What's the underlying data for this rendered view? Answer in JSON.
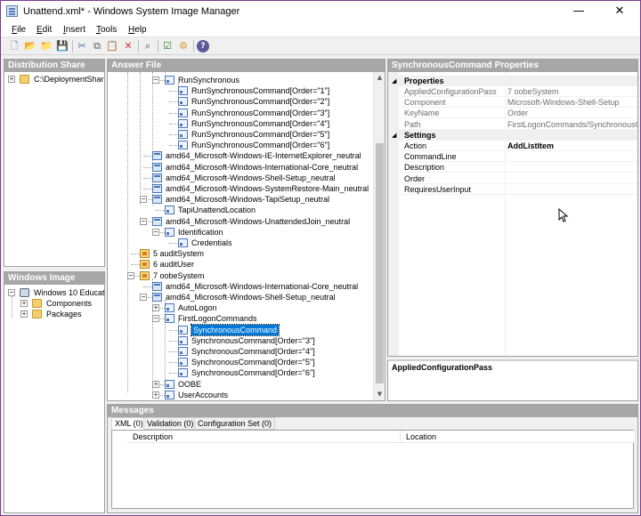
{
  "window": {
    "title": "Unattend.xml* - Windows System Image Manager",
    "minimize": "—",
    "maximize": "☐",
    "close": "✕"
  },
  "menu": [
    "File",
    "Edit",
    "Insert",
    "Tools",
    "Help"
  ],
  "toolbar_icons": [
    "new-icon",
    "open-icon",
    "open-folder-icon",
    "save-icon",
    "cut-icon",
    "copy-icon",
    "paste-icon",
    "delete-icon",
    "search-icon",
    "validate-icon",
    "create-config-set-icon",
    "help-icon"
  ],
  "distribution_share": {
    "header": "Distribution Share",
    "root": "C:\\DeploymentShare"
  },
  "windows_image": {
    "header": "Windows Image",
    "root": "Windows 10 Educatio",
    "children": [
      "Components",
      "Packages"
    ]
  },
  "answer_file": {
    "header": "Answer File",
    "rows": [
      {
        "label": "RunSynchronous",
        "icon": "set",
        "expander": "−"
      },
      {
        "label": "RunSynchronousCommand[Order=\"1\"]",
        "icon": "set",
        "expander": ""
      },
      {
        "label": "RunSynchronousCommand[Order=\"2\"]",
        "icon": "set",
        "expander": ""
      },
      {
        "label": "RunSynchronousCommand[Order=\"3\"]",
        "icon": "set",
        "expander": ""
      },
      {
        "label": "RunSynchronousCommand[Order=\"4\"]",
        "icon": "set",
        "expander": ""
      },
      {
        "label": "RunSynchronousCommand[Order=\"5\"]",
        "icon": "set",
        "expander": ""
      },
      {
        "label": "RunSynchronousCommand[Order=\"6\"]",
        "icon": "set",
        "expander": ""
      },
      {
        "label": "amd64_Microsoft-Windows-IE-InternetExplorer_neutral",
        "icon": "comp",
        "expander": ""
      },
      {
        "label": "amd64_Microsoft-Windows-International-Core_neutral",
        "icon": "comp",
        "expander": ""
      },
      {
        "label": "amd64_Microsoft-Windows-Shell-Setup_neutral",
        "icon": "comp",
        "expander": ""
      },
      {
        "label": "amd64_Microsoft-Windows-SystemRestore-Main_neutral",
        "icon": "comp",
        "expander": ""
      },
      {
        "label": "amd64_Microsoft-Windows-TapiSetup_neutral",
        "icon": "comp",
        "expander": "−"
      },
      {
        "label": "TapiUnattendLocation",
        "icon": "set",
        "expander": ""
      },
      {
        "label": "amd64_Microsoft-Windows-UnattendedJoin_neutral",
        "icon": "comp",
        "expander": "−"
      },
      {
        "label": "Identification",
        "icon": "set",
        "expander": "−"
      },
      {
        "label": "Credentials",
        "icon": "set",
        "expander": ""
      },
      {
        "label": "5 auditSystem",
        "icon": "pass",
        "expander": ""
      },
      {
        "label": "6 auditUser",
        "icon": "pass",
        "expander": ""
      },
      {
        "label": "7 oobeSystem",
        "icon": "pass",
        "expander": "−"
      },
      {
        "label": "amd64_Microsoft-Windows-International-Core_neutral",
        "icon": "comp",
        "expander": ""
      },
      {
        "label": "amd64_Microsoft-Windows-Shell-Setup_neutral",
        "icon": "comp",
        "expander": "−"
      },
      {
        "label": "AutoLogon",
        "icon": "set",
        "expander": "+"
      },
      {
        "label": "FirstLogonCommands",
        "icon": "set",
        "expander": "−"
      },
      {
        "label": "SynchronousCommand",
        "icon": "set",
        "expander": "",
        "selected": true
      },
      {
        "label": "SynchronousCommand[Order=\"3\"]",
        "icon": "set",
        "expander": ""
      },
      {
        "label": "SynchronousCommand[Order=\"4\"]",
        "icon": "set",
        "expander": ""
      },
      {
        "label": "SynchronousCommand[Order=\"5\"]",
        "icon": "set",
        "expander": ""
      },
      {
        "label": "SynchronousCommand[Order=\"6\"]",
        "icon": "set",
        "expander": ""
      },
      {
        "label": "OOBE",
        "icon": "set",
        "expander": "+"
      },
      {
        "label": "UserAccounts",
        "icon": "set",
        "expander": "+"
      }
    ]
  },
  "properties": {
    "header": "SynchronousCommand Properties",
    "cat_properties": "Properties",
    "cat_settings": "Settings",
    "props": [
      {
        "name": "AppliedConfigurationPass",
        "value": "7 oobeSystem"
      },
      {
        "name": "Component",
        "value": "Microsoft-Windows-Shell-Setup"
      },
      {
        "name": "KeyName",
        "value": "Order"
      },
      {
        "name": "Path",
        "value": "FirstLogonCommands/SynchronousComm"
      }
    ],
    "settings": [
      {
        "name": "Action",
        "value": "AddListItem"
      },
      {
        "name": "CommandLine",
        "value": ""
      },
      {
        "name": "Description",
        "value": ""
      },
      {
        "name": "Order",
        "value": ""
      },
      {
        "name": "RequiresUserInput",
        "value": ""
      }
    ],
    "description_title": "AppliedConfigurationPass"
  },
  "messages": {
    "header": "Messages",
    "tabs": [
      "XML (0)",
      "Validation (0)",
      "Configuration Set (0)"
    ],
    "col_description": "Description",
    "col_location": "Location"
  }
}
